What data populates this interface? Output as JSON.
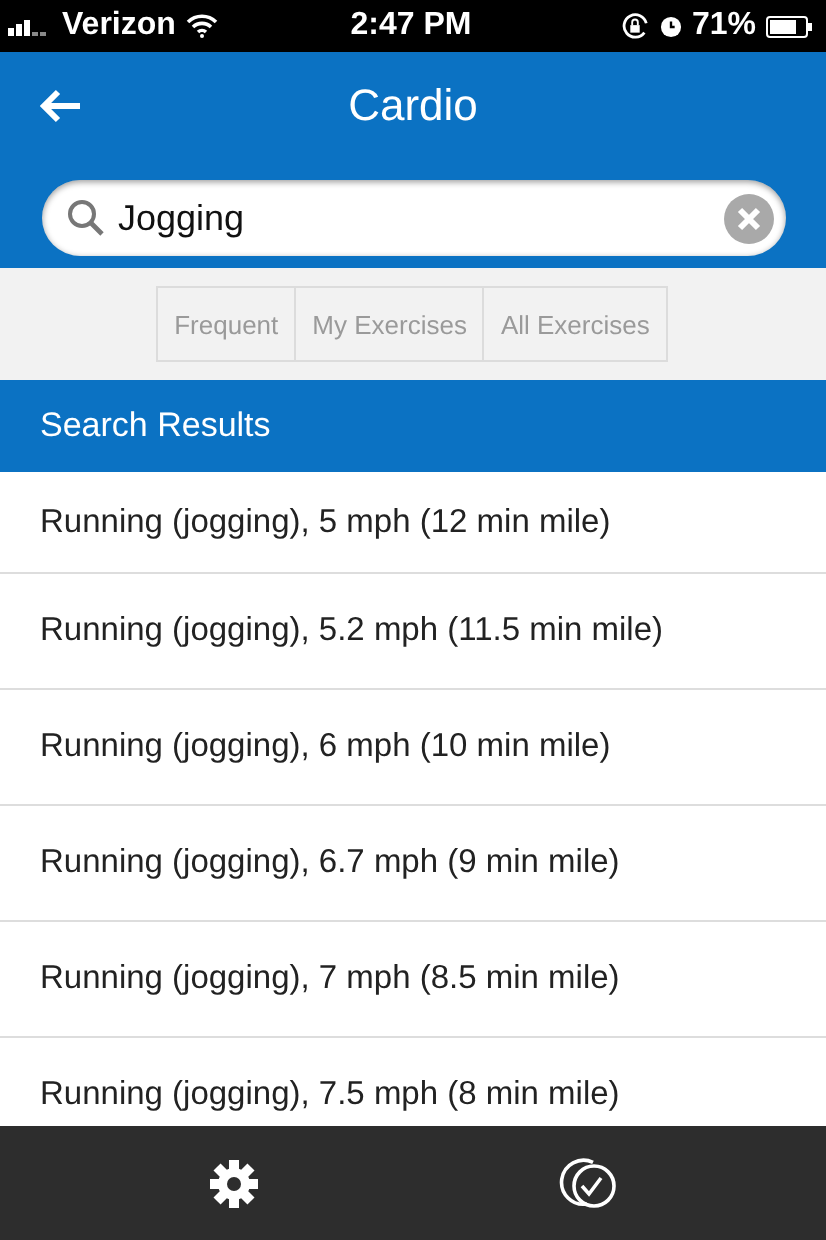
{
  "status_bar": {
    "carrier": "Verizon",
    "time": "2:47 PM",
    "battery": "71%"
  },
  "header": {
    "title": "Cardio"
  },
  "search": {
    "value": "Jogging"
  },
  "tabs": [
    {
      "label": "Frequent",
      "selected": false
    },
    {
      "label": "My Exercises",
      "selected": false
    },
    {
      "label": "All Exercises",
      "selected": false
    }
  ],
  "section": {
    "title": "Search Results"
  },
  "results": [
    "Running (jogging), 5 mph (12 min mile)",
    "Running (jogging), 5.2 mph (11.5 min mile)",
    "Running (jogging), 6 mph (10 min mile)",
    "Running (jogging), 6.7 mph (9 min mile)",
    "Running (jogging), 7 mph (8.5 min mile)",
    "Running (jogging), 7.5 mph (8 min mile)"
  ]
}
